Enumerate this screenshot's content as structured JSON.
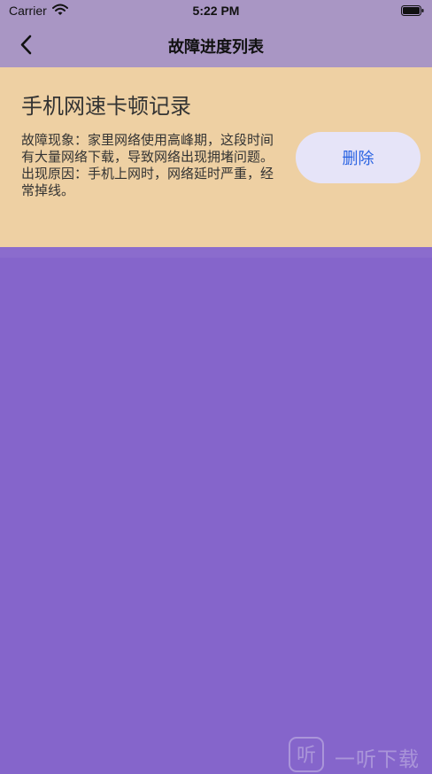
{
  "status_bar": {
    "carrier": "Carrier",
    "time": "5:22 PM",
    "wifi_icon": "wifi-icon",
    "battery_icon": "battery-icon"
  },
  "nav": {
    "back_icon": "chevron-left-icon",
    "title": "故障进度列表"
  },
  "records": [
    {
      "title": "手机网速卡顿记录",
      "phenomenon": "故障现象：家里网络使用高峰期，这段时间有大量网络下载，导致网络出现拥堵问题。",
      "cause": "出现原因：手机上网时，网络延时严重，经常掉线。",
      "delete_label": "删除"
    }
  ],
  "watermark": {
    "logo_text": "听",
    "text": "一听下载"
  },
  "colors": {
    "page_background": "#8565cb",
    "nav_background": "#a996c4",
    "card_background": "#eed0a3",
    "delete_button_background": "#e6e4f8",
    "delete_button_text": "#2a63e2"
  }
}
